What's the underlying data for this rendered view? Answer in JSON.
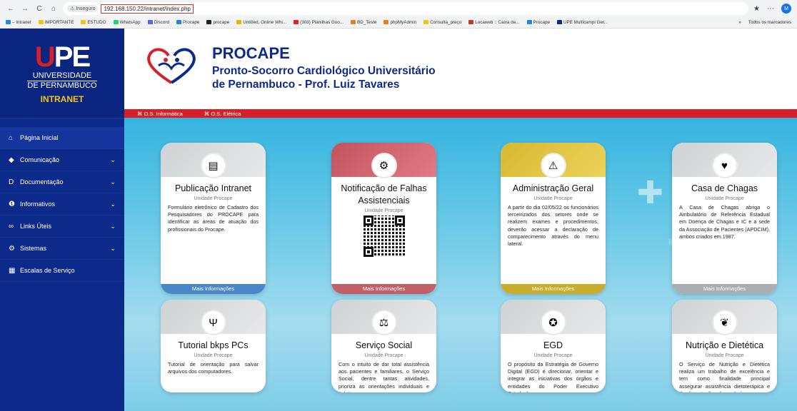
{
  "browser": {
    "back": "←",
    "forward": "→",
    "reload": "C",
    "home": "⌂",
    "insecure_label": "⚠ Inseguro",
    "url": "192.168.150.22/intranet/index.php",
    "star": "★",
    "extensions": "⋯",
    "profile": "M",
    "bookmarks": [
      {
        "label": "– Intranet",
        "color": "#1e88e5"
      },
      {
        "label": "IMPORTANTE",
        "color": "#f1c40f"
      },
      {
        "label": "ESTUDO",
        "color": "#f1c40f"
      },
      {
        "label": "WhatsApp",
        "color": "#25d366"
      },
      {
        "label": "Discord",
        "color": "#5865f2"
      },
      {
        "label": "Procape",
        "color": "#1e88e5"
      },
      {
        "label": "procape",
        "color": "#222"
      },
      {
        "label": "Untitled, Online Whi...",
        "color": "#e6b800"
      },
      {
        "label": "(303) Planilhas Goo...",
        "color": "#e62117"
      },
      {
        "label": "BD_Teste",
        "color": "#e67e22"
      },
      {
        "label": "phpMyAdmin",
        "color": "#e67e22"
      },
      {
        "label": "Consulta_preço",
        "color": "#f1c40f"
      },
      {
        "label": "Locaweb :: Caixa de...",
        "color": "#c0392b"
      },
      {
        "label": "Procape",
        "color": "#1e88e5"
      },
      {
        "label": "UPE Multicampi Ger...",
        "color": "#0c2a8a"
      }
    ],
    "bookmarks_more": "»",
    "all_bookmarks": "Todos os marcadores"
  },
  "sidebar": {
    "logo_u": "U",
    "logo_pe": "PE",
    "logo_line1": "UNIVERSIDADE",
    "logo_line2": "DE PERNAMBUCO",
    "logo_intranet": "INTRANET",
    "items": [
      {
        "label": "Página Inicial",
        "icon": "home-icon",
        "glyph": "⌂",
        "chevron": ""
      },
      {
        "label": "Comunicação",
        "icon": "megaphone-icon",
        "glyph": "◆",
        "chevron": "⌄"
      },
      {
        "label": "Documentação",
        "icon": "document-icon",
        "glyph": "D",
        "chevron": "⌄"
      },
      {
        "label": "Informativos",
        "icon": "info-icon",
        "glyph": "❶",
        "chevron": "⌄"
      },
      {
        "label": "Links Úteis",
        "icon": "link-icon",
        "glyph": "∞",
        "chevron": "⌄"
      },
      {
        "label": "Sistemas",
        "icon": "gear-icon",
        "glyph": "⚙",
        "chevron": "⌄"
      },
      {
        "label": "Escalas de Serviço",
        "icon": "calendar-icon",
        "glyph": "▦",
        "chevron": ""
      }
    ]
  },
  "header": {
    "title": "PROCAPE",
    "subtitle_line1": "Pronto-Socorro Cardiológico Universitário",
    "subtitle_line2": "de Pernambuco - Prof. Luiz Tavares",
    "redbar_links": [
      "⌘ O.S. Informática",
      "⌘ O.S. Elétrica"
    ]
  },
  "cards": [
    {
      "title": "Publicação Intranet",
      "unit": "Unidade Procape",
      "body": "Formulário eletrônico de Cadastro dos Pesquisadores do PROCAPE para identificar as áreas de atuação dos profissionais do Procape.",
      "footer": "Mais Informações",
      "head": "gray",
      "foot_color": "#4a86c8",
      "icon": "document-icon",
      "glyph": "▤"
    },
    {
      "title": "Notificação de Falhas Assistenciais",
      "unit": "Unidade Procape",
      "body": "",
      "footer": "Mais Informações",
      "head": "red",
      "foot_color": "#c2606a",
      "icon": "gears-icon",
      "glyph": "⚙"
    },
    {
      "title": "Administração Geral",
      "unit": "Unidade Procape",
      "body": "A partir do dia 02/05/22 os funcionários terceirizados dos setores onde se realizem exames e procedimentos, deverão acessar a declaração de comparecimento através do menu lateral.",
      "footer": "Mais Informações",
      "head": "yellow",
      "foot_color": "#c9ac2b",
      "icon": "warning-icon",
      "glyph": "⚠"
    },
    {
      "title": "Casa de Chagas",
      "unit": "Unidade Procape",
      "body": "A Casa de Chagas abriga o Ambulatório de Referência Estadual em Doença de Chagas e IC e a sede da Associação de Pacientes (APDCIM), ambos criados em 1987.",
      "footer": "Mais Informações",
      "head": "gray",
      "foot_color": "#a9aeb3",
      "icon": "heart-icon",
      "glyph": "♥"
    },
    {
      "title": "Tutorial bkps PCs",
      "unit": "Unidade Procape",
      "body": "Tutorial de orientação para salvar arquivos dos computadores.",
      "footer": "",
      "head": "gray",
      "foot_color": "#4a86c8",
      "icon": "psi-icon",
      "glyph": "Ψ"
    },
    {
      "title": "Serviço Social",
      "unit": "Unidade Procape",
      "body": "Com o intuito de dar total assistência aos pacientes e familiares, o Serviço Social, dentre tantas atividades, prioriza as orientações individuais e coletivas.",
      "footer": "",
      "head": "gray",
      "foot_color": "#4a86c8",
      "icon": "scales-icon",
      "glyph": "⚖"
    },
    {
      "title": "EGD",
      "unit": "Unidade Procape",
      "body": "O propósito da Estratégia de Governo Digital (EGD) é direcionar, orientar e integrar as iniciativas dos órgãos e entidades do Poder Executivo Estadual.",
      "footer": "",
      "head": "gray",
      "foot_color": "#4a86c8",
      "icon": "seal-icon",
      "glyph": "✪"
    },
    {
      "title": "Nutrição e Dietética",
      "unit": "Unidade Procape",
      "body": "O Serviço de Nutrição e Dietética realiza um trabalho de excelência e tem como finalidade principal assegurar assistência dietoterápica e de alimentação adequada à",
      "footer": "",
      "head": "gray",
      "foot_color": "#4a86c8",
      "icon": "nutrition-icon",
      "glyph": "❦"
    }
  ]
}
